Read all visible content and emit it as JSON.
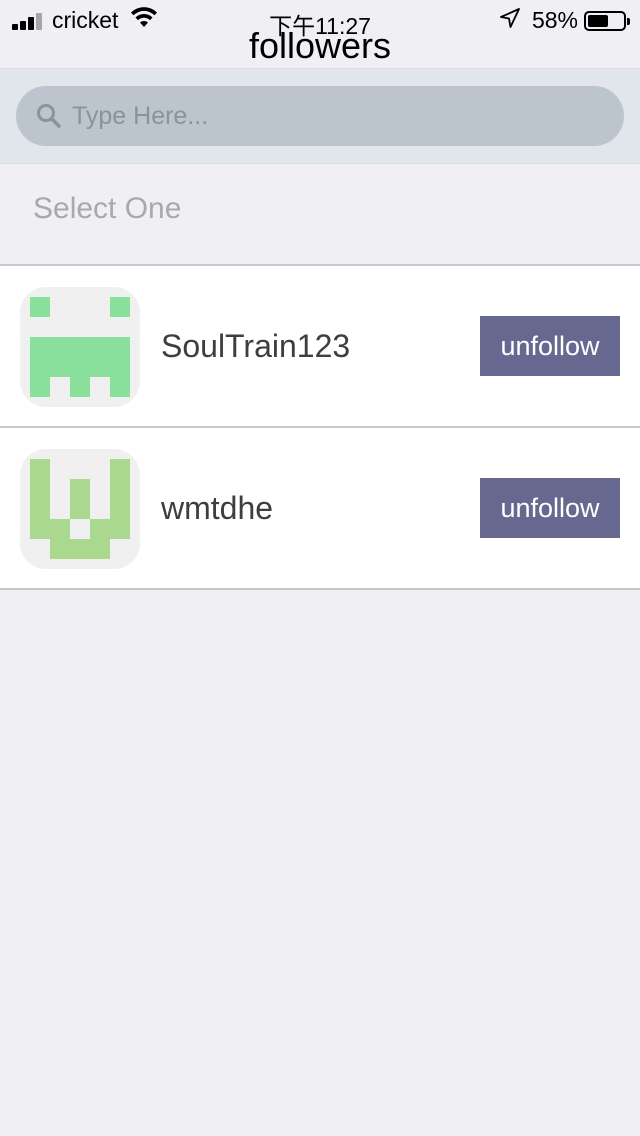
{
  "status_bar": {
    "carrier": "cricket",
    "time": "下午11:27",
    "battery_percent_text": "58%",
    "battery_level": 0.58
  },
  "nav": {
    "title": "followers"
  },
  "search": {
    "placeholder": "Type Here...",
    "value": ""
  },
  "section": {
    "header": "Select One"
  },
  "followers": [
    {
      "username": "SoulTrain123",
      "button_label": "unfollow",
      "avatar_color": "#88e09c",
      "avatar_icon": "identicon-avatar"
    },
    {
      "username": "wmtdhe",
      "button_label": "unfollow",
      "avatar_color": "#a9d88e",
      "avatar_icon": "identicon-avatar"
    }
  ],
  "colors": {
    "button_bg": "#666890",
    "search_bar_bg": "#e1e6ec",
    "search_field_bg": "#bcc4cd",
    "page_bg": "#efeff4"
  }
}
